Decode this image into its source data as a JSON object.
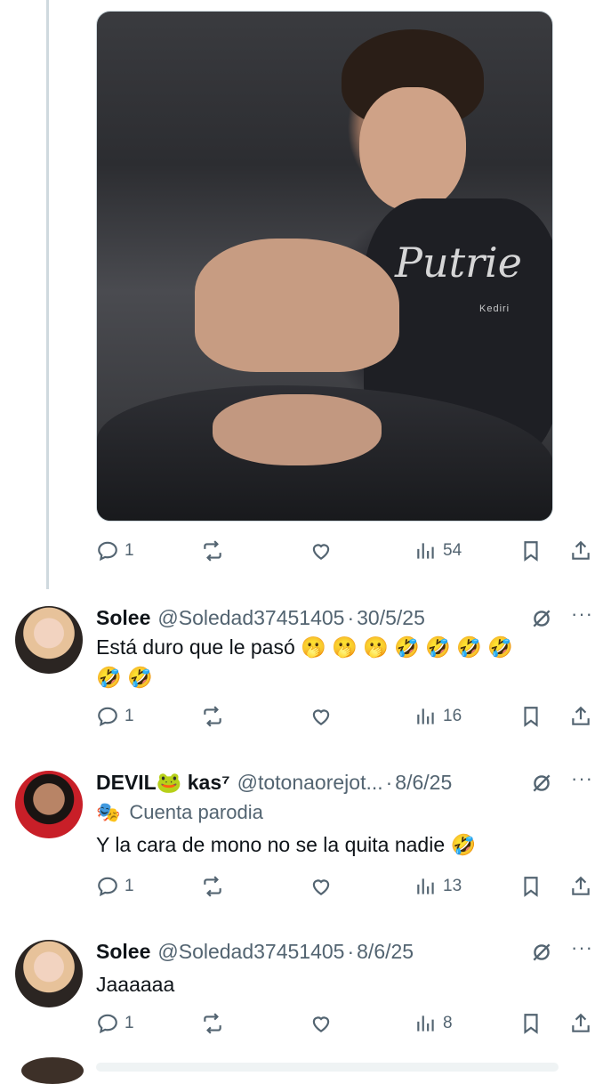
{
  "main_post": {
    "media": {
      "watermark": "Putrie",
      "watermark_sub": "Kediri"
    },
    "stats": {
      "replies": "1",
      "views": "54"
    }
  },
  "replies": [
    {
      "name": "Solee",
      "handle": "@Soledad37451405",
      "separator": "·",
      "date": "30/5/25",
      "text_line1": "Está duro que le pasó 🫢 🫢 🫢 🤣 🤣 🤣 🤣",
      "text_line2": "🤣 🤣",
      "stats": {
        "replies": "1",
        "views": "16"
      }
    },
    {
      "name": "DEVIL🐸 kas⁷",
      "handle": "@totonaorejot...",
      "separator": "·",
      "date": "8/6/25",
      "label_icon": "🎭",
      "label": "Cuenta parodia",
      "text_line1": "Y la cara de mono no se la quita nadie 🤣",
      "stats": {
        "replies": "1",
        "views": "13"
      }
    },
    {
      "name": "Solee",
      "handle": "@Soledad37451405",
      "separator": "·",
      "date": "8/6/25",
      "text_line1": "Jaaaaaa",
      "stats": {
        "replies": "1",
        "views": "8"
      }
    }
  ],
  "more_label": "···",
  "colors": {
    "secondary": "#536471",
    "primary_text": "#0f1419",
    "line": "#cfd9de"
  },
  "icons": [
    "reply-icon",
    "repost-icon",
    "like-icon",
    "views-icon",
    "bookmark-icon",
    "share-icon",
    "grok-icon"
  ]
}
